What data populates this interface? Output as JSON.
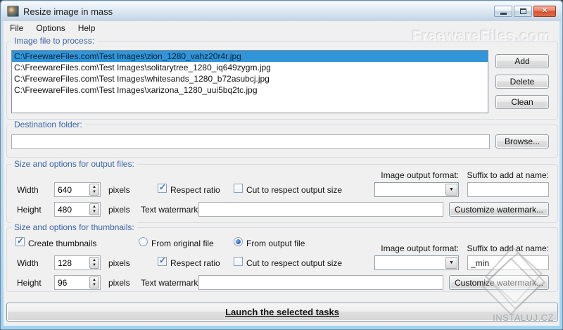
{
  "window": {
    "title": "Resize image in mass",
    "controls": {
      "minimize": "minimize",
      "maximize": "maximize",
      "close": "close"
    }
  },
  "watermarks": {
    "top_right": "FreewareFiles.com",
    "bottom_right": "INSTALUJ.CZ"
  },
  "menu": {
    "items": [
      "File",
      "Options",
      "Help"
    ]
  },
  "file_group": {
    "label": "Image file to process:",
    "selected_index": 0,
    "files": [
      "C:\\FreewareFiles.com\\Test Images\\zion_1280_vahz20r4r.jpg",
      "C:\\FreewareFiles.com\\Test Images\\solitarytree_1280_iq649zygm.jpg",
      "C:\\FreewareFiles.com\\Test Images\\whitesands_1280_b72asubcj.jpg",
      "C:\\FreewareFiles.com\\Test Images\\xarizona_1280_uui5bq2tc.jpg"
    ],
    "buttons": {
      "add": "Add",
      "delete": "Delete",
      "clean": "Clean"
    }
  },
  "destination": {
    "label": "Destination folder:",
    "value": "",
    "browse": "Browse..."
  },
  "output": {
    "label": "Size and options for output files:",
    "width_label": "Width",
    "width": "640",
    "height_label": "Height",
    "height": "480",
    "pixels": "pixels",
    "respect_ratio": {
      "label": "Respect ratio",
      "checked": true
    },
    "cut": {
      "label": "Cut to respect output size",
      "checked": false
    },
    "format_label": "Image output format:",
    "format_value": "",
    "suffix_label": "Suffix to add at name:",
    "suffix_value": "",
    "watermark_label": "Text watermark:",
    "watermark_value": "",
    "customize": "Customize watermark..."
  },
  "thumbs": {
    "label": "Size and options for thumbnails:",
    "create": {
      "label": "Create thumbnails",
      "checked": true
    },
    "source": {
      "original": {
        "label": "From original file",
        "selected": false
      },
      "output": {
        "label": "From output file",
        "selected": true
      }
    },
    "width_label": "Width",
    "width": "128",
    "height_label": "Height",
    "height": "96",
    "pixels": "pixels",
    "respect_ratio": {
      "label": "Respect ratio",
      "checked": true
    },
    "cut": {
      "label": "Cut to respect output size",
      "checked": false
    },
    "format_label": "Image output format:",
    "format_value": "",
    "suffix_label": "Suffix to add at name:",
    "suffix_value": "_min",
    "watermark_label": "Text watermark:",
    "watermark_value": "",
    "customize": "Customize watermark..."
  },
  "launch": {
    "label": "Launch the selected tasks"
  },
  "colors": {
    "selection_bg": "#3095d9",
    "group_caption": "#3a62a9",
    "close_button": "#d6532f",
    "check_mark": "#3b6cc0",
    "radio_dot": "#2a5fb8",
    "client_bg": "#f0f0f0"
  },
  "icons": {
    "minimize": "—",
    "maximize": "▢",
    "close": "✕",
    "combo_arrow": "▼",
    "spin_up": "▲",
    "spin_down": "▼"
  }
}
